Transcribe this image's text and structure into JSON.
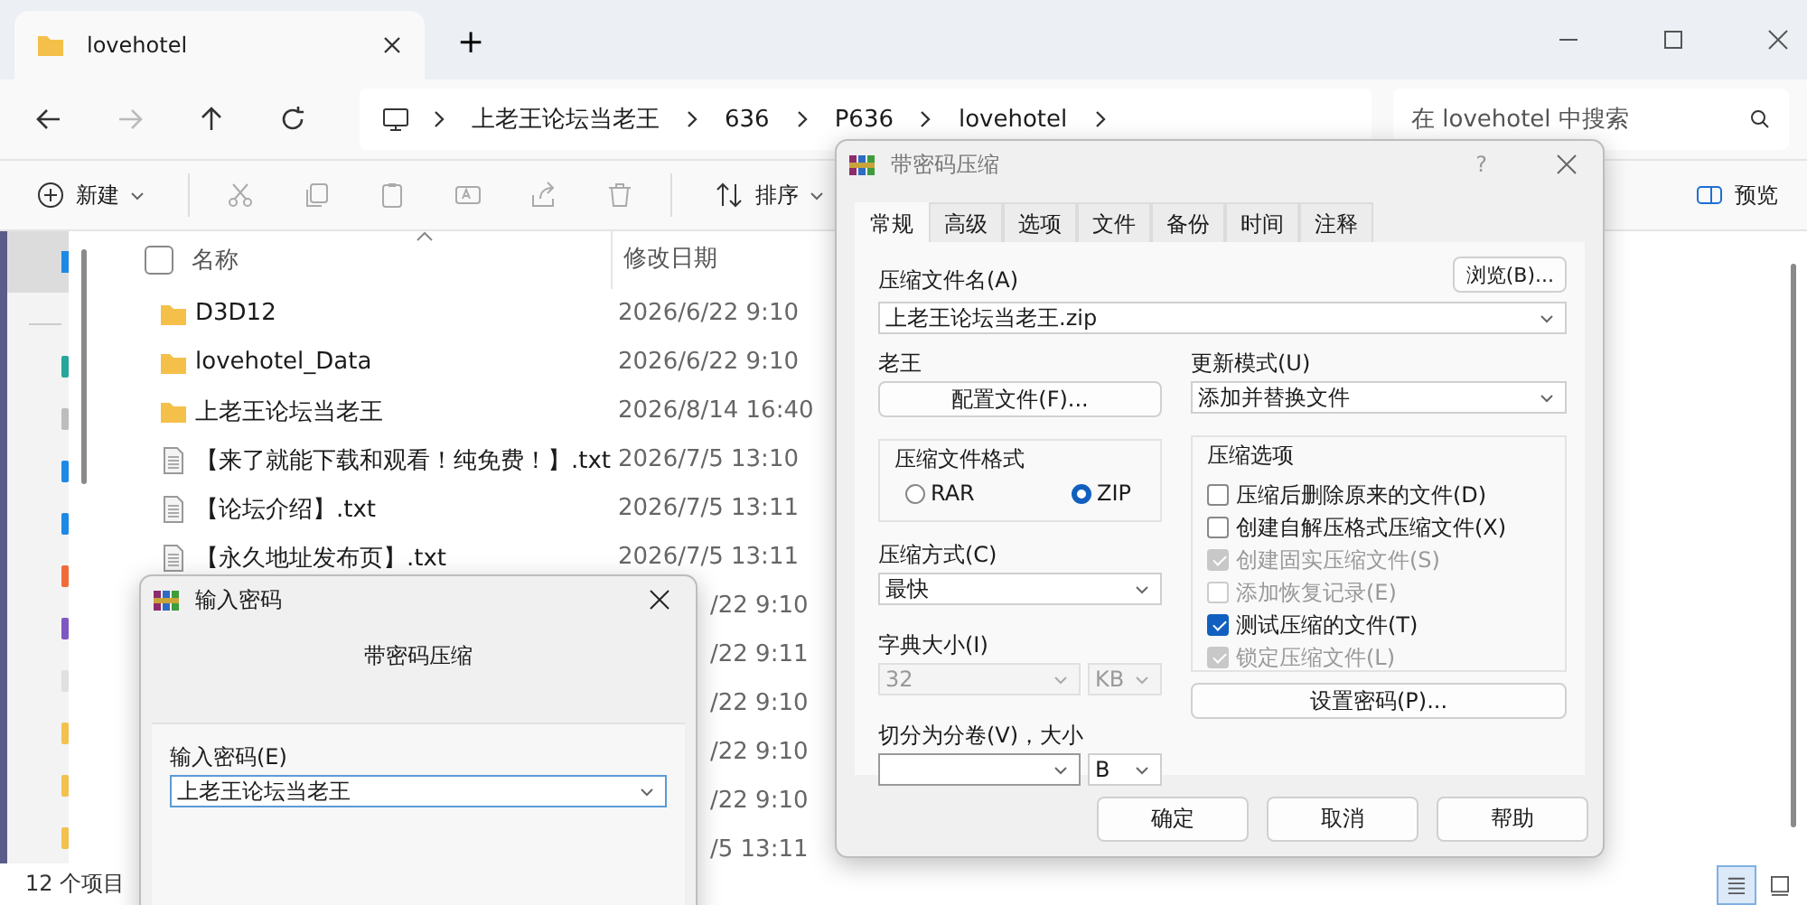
{
  "explorer": {
    "tab": {
      "title": "lovehotel"
    },
    "new_tab": "+",
    "breadcrumb": [
      "上老王论坛当老王",
      "636",
      "P636",
      "lovehotel"
    ],
    "search": {
      "placeholder": "在 lovehotel 中搜索"
    },
    "toolbar": {
      "new": "新建",
      "sort": "排序",
      "preview": "预览"
    },
    "select_all": {
      "checked": false
    },
    "columns": [
      "名称",
      "修改日期"
    ],
    "rows": [
      {
        "kind": "folder",
        "name": "D3D12",
        "date": "2026/6/22 9:10"
      },
      {
        "kind": "folder",
        "name": "lovehotel_Data",
        "date": "2026/6/22 9:10"
      },
      {
        "kind": "folder",
        "name": "上老王论坛当老王",
        "date": "2026/8/14 16:40"
      },
      {
        "kind": "file",
        "name": "【来了就能下载和观看！纯免费！】.txt",
        "date": "2026/7/5 13:10"
      },
      {
        "kind": "file",
        "name": "【论坛介绍】.txt",
        "date": "2026/7/5 13:11"
      },
      {
        "kind": "file",
        "name": "【永久地址发布页】.txt",
        "date": "2026/7/5 13:11"
      },
      {
        "kind": "partial",
        "date": "/22 9:10"
      },
      {
        "kind": "partial",
        "date": "/22 9:11"
      },
      {
        "kind": "partial",
        "date": "/22 9:10"
      },
      {
        "kind": "partial",
        "date": "/22 9:10"
      },
      {
        "kind": "partial",
        "date": "/22 9:10"
      },
      {
        "kind": "partial",
        "date": "/5 13:11"
      }
    ],
    "status": "12 个项目",
    "views": [
      {
        "kind": "details",
        "selected": true
      },
      {
        "kind": "tiles",
        "selected": false
      }
    ]
  },
  "archive_dialog": {
    "title": "带密码压缩",
    "help": "?",
    "tabs": [
      {
        "label": "常规",
        "selected": true
      },
      {
        "label": "高级",
        "selected": false
      },
      {
        "label": "选项",
        "selected": false
      },
      {
        "label": "文件",
        "selected": false
      },
      {
        "label": "备份",
        "selected": false
      },
      {
        "label": "时间",
        "selected": false
      },
      {
        "label": "注释",
        "selected": false
      }
    ],
    "archive_name_label": "压缩文件名(A)",
    "browse_button": "浏览(B)...",
    "archive_name": "上老王论坛当老王.zip",
    "profile_label": "老王",
    "profile_button": "配置文件(F)...",
    "update_mode_label": "更新模式(U)",
    "update_mode": "添加并替换文件",
    "format_group": "压缩文件格式",
    "formats": [
      {
        "label": "RAR",
        "selected": false
      },
      {
        "label": "ZIP",
        "selected": true
      }
    ],
    "method_label": "压缩方式(C)",
    "method": "最快",
    "dict_label": "字典大小(I)",
    "dict_value": "32",
    "dict_unit": "KB",
    "dict_disabled": true,
    "split_label": "切分为分卷(V)，大小",
    "split_unit": "B",
    "options_group": "压缩选项",
    "options": [
      {
        "label": "压缩后删除原来的文件(D)",
        "checked": false,
        "disabled": false
      },
      {
        "label": "创建自解压格式压缩文件(X)",
        "checked": false,
        "disabled": false
      },
      {
        "label": "创建固实压缩文件(S)",
        "checked": true,
        "disabled": true
      },
      {
        "label": "添加恢复记录(E)",
        "checked": false,
        "disabled": true
      },
      {
        "label": "测试压缩的文件(T)",
        "checked": true,
        "disabled": false
      },
      {
        "label": "锁定压缩文件(L)",
        "checked": true,
        "disabled": true
      }
    ],
    "password_button": "设置密码(P)...",
    "buttons": [
      "确定",
      "取消",
      "帮助"
    ]
  },
  "password_dialog": {
    "title": "输入密码",
    "heading": "带密码压缩",
    "label": "输入密码(E)",
    "value": "上老王论坛当老王"
  }
}
